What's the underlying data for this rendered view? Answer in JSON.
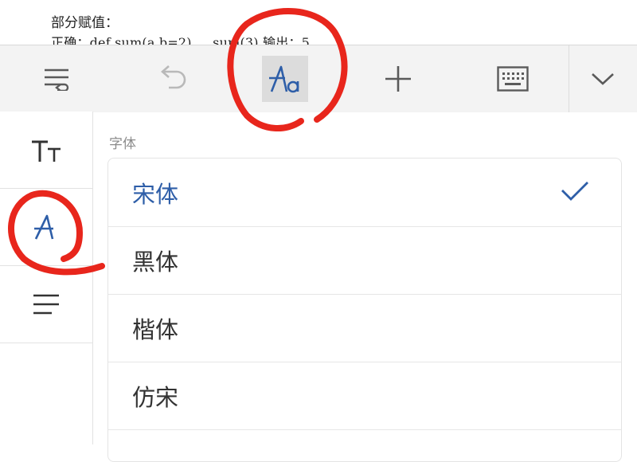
{
  "document": {
    "line1": "部分赋值：",
    "line2": "正确：def sum(a,b=2) ... sum(3)  输出：5"
  },
  "toolbar": {
    "buttons": [
      {
        "name": "paragraph-format-icon"
      },
      {
        "name": "undo-icon"
      },
      {
        "name": "font-style-icon",
        "active": true
      },
      {
        "name": "insert-plus-icon"
      },
      {
        "name": "keyboard-icon"
      },
      {
        "name": "collapse-chevron-icon"
      }
    ]
  },
  "sidebar": {
    "tabs": [
      {
        "name": "text-size-icon"
      },
      {
        "name": "font-icon",
        "active": true
      },
      {
        "name": "paragraph-align-icon"
      }
    ]
  },
  "font_panel": {
    "section_title": "字体",
    "fonts": [
      {
        "label": "宋体",
        "selected": true
      },
      {
        "label": "黑体"
      },
      {
        "label": "楷体"
      },
      {
        "label": "仿宋"
      }
    ]
  },
  "colors": {
    "accent": "#2e5ea8",
    "annotation": "#e8261c",
    "toolbar_bg": "#f3f3f3"
  }
}
